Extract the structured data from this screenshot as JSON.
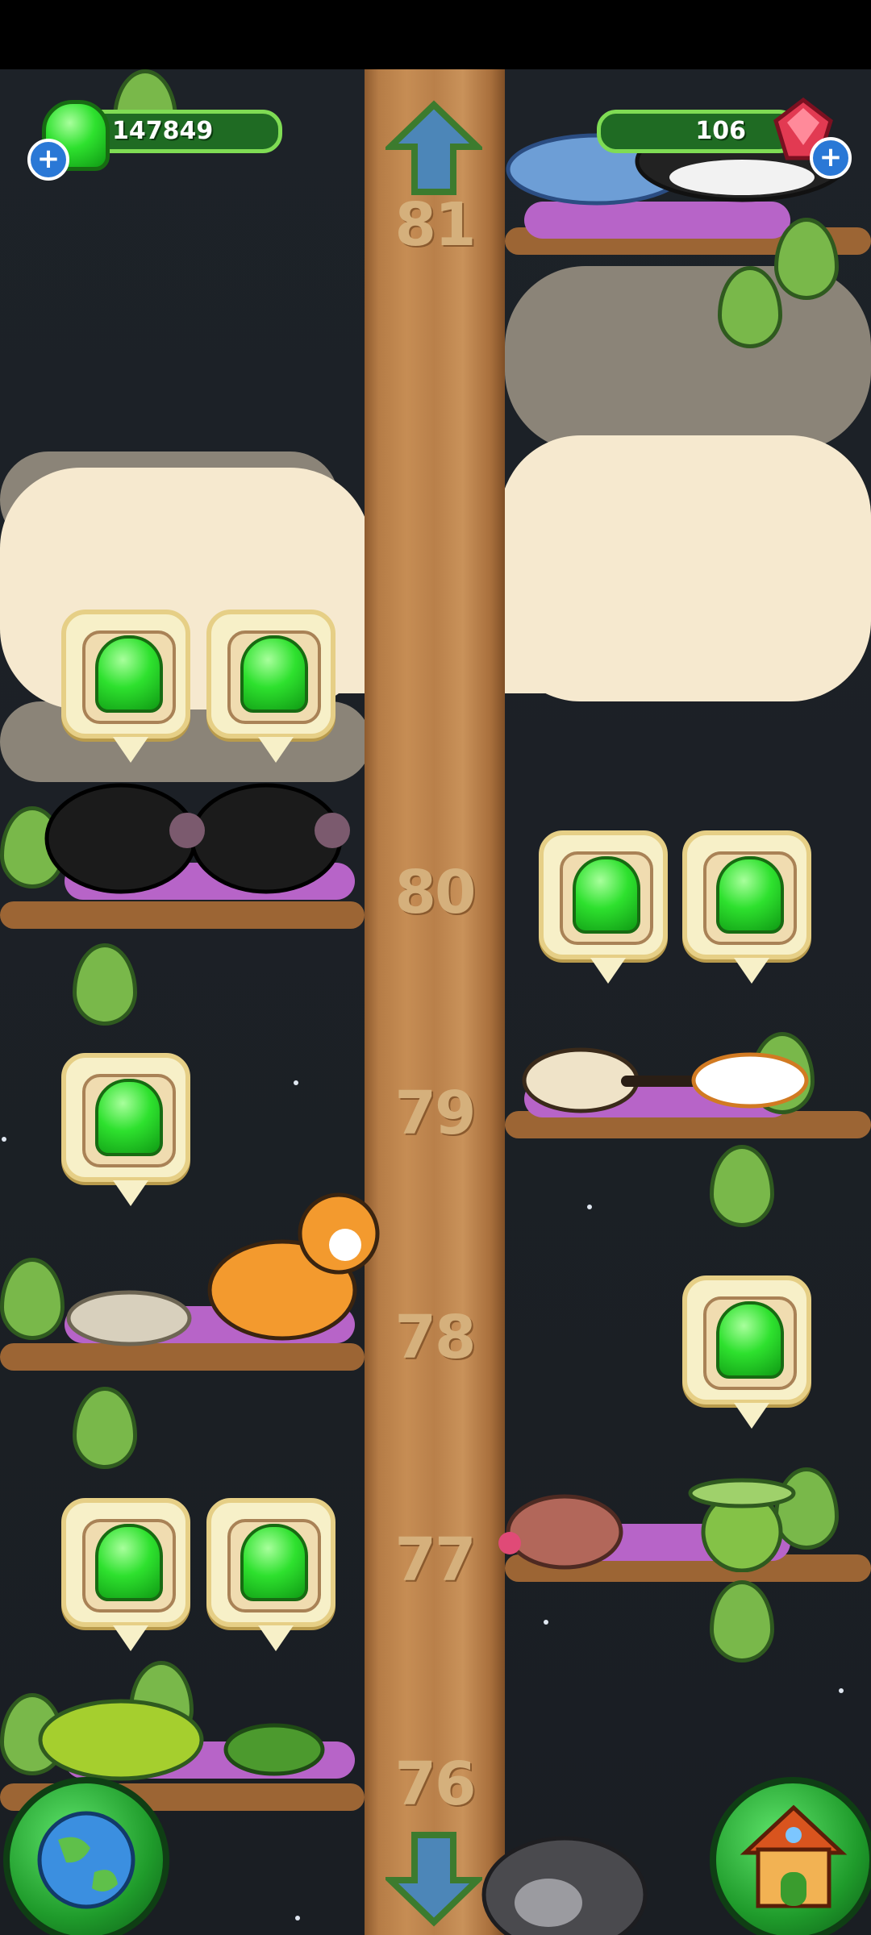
{
  "hud": {
    "gems": {
      "value": "147849",
      "icon": "green-gem-icon",
      "add_icon": "plus-icon"
    },
    "rubies": {
      "value": "106",
      "icon": "red-crystal-icon",
      "add_icon": "plus-icon"
    }
  },
  "levels": [
    "81",
    "80",
    "79",
    "78",
    "77",
    "76"
  ],
  "navigation": {
    "up_icon": "arrow-up-icon",
    "down_icon": "arrow-down-icon"
  },
  "buttons": {
    "map_icon": "globe-icon",
    "home_icon": "house-icon"
  },
  "animals": [
    "dolphin",
    "orca",
    "black-sheep",
    "black-sheep",
    "bird",
    "koi",
    "tiger",
    "sleeping-cat",
    "mole",
    "turtle-bird",
    "turtle",
    "frog",
    "gorilla"
  ],
  "colors": {
    "gem_green": "#2ee12e",
    "trunk": "#c68d54",
    "leaf": "#79b84a",
    "nest": "#b764c8",
    "sky": "#1d2228"
  }
}
